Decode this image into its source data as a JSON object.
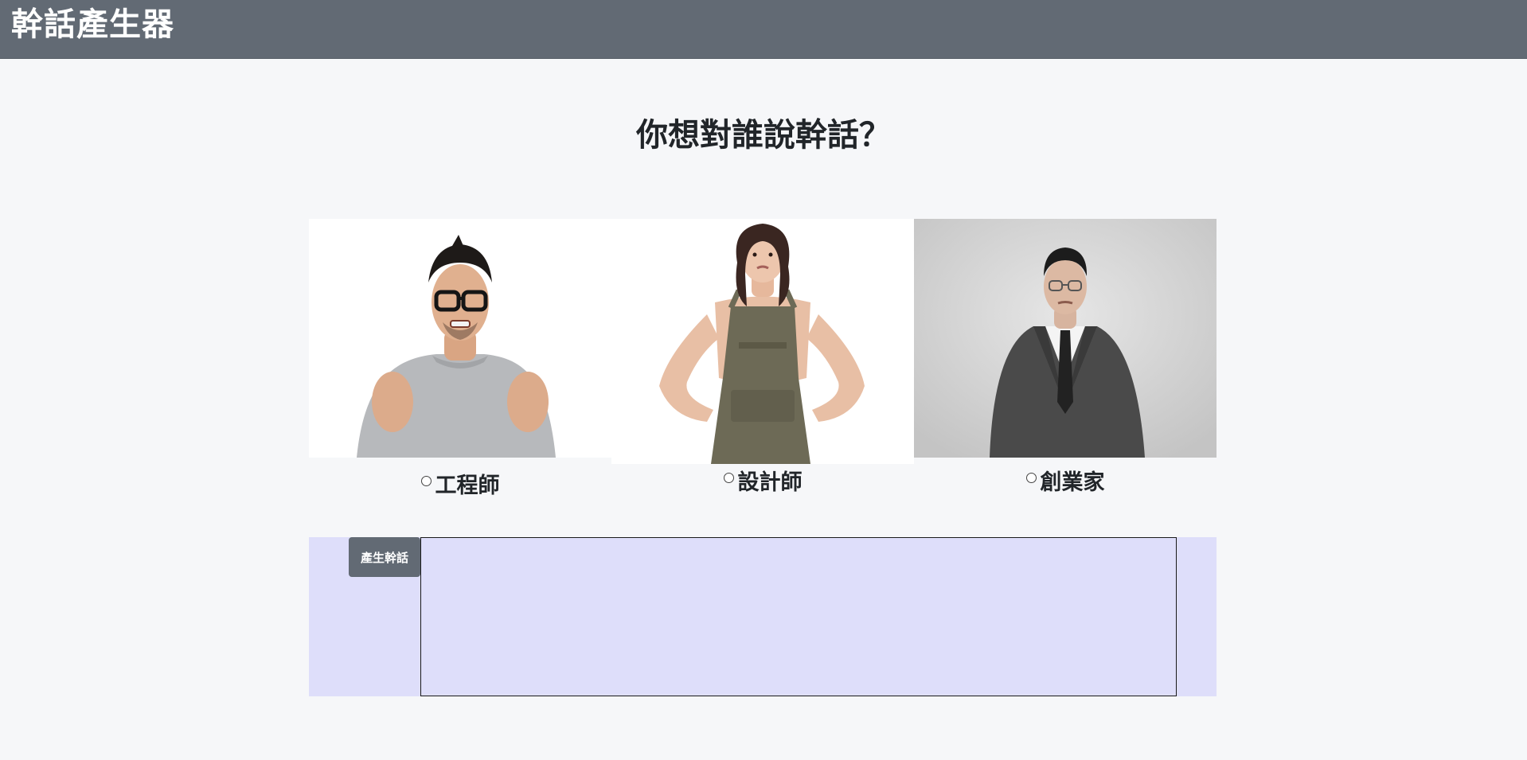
{
  "navbar": {
    "brand": "幹話產生器"
  },
  "main": {
    "question": "你想對誰說幹話？"
  },
  "roles": [
    {
      "label": "工程師",
      "icon": "engineer-photo"
    },
    {
      "label": "設計師",
      "icon": "designer-photo"
    },
    {
      "label": "創業家",
      "icon": "entrepreneur-photo"
    }
  ],
  "generator": {
    "button_label": "產生幹話",
    "result_text": ""
  },
  "colors": {
    "navbar": "#626a74",
    "panel": "#dedefa",
    "page": "#f6f7f9"
  }
}
